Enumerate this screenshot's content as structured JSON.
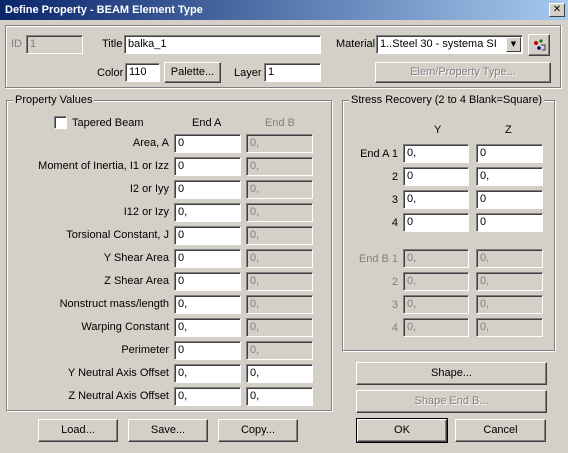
{
  "window": {
    "title": "Define Property - BEAM Element Type",
    "close_glyph": "✕"
  },
  "header": {
    "id_label": "ID",
    "id_value": "1",
    "title_label": "Title",
    "title_value": "balka_1",
    "material_label": "Material",
    "material_value": "1..Steel 30 - systema SI",
    "color_label": "Color",
    "color_value": "110",
    "palette_button": "Palette...",
    "layer_label": "Layer",
    "layer_value": "1",
    "elem_type_button": "Elem/Property Type..."
  },
  "property_values": {
    "group_title": "Property Values",
    "tapered_beam_label": "Tapered Beam",
    "tapered_beam_checked": false,
    "end_a_header": "End A",
    "end_b_header": "End B",
    "rows": [
      {
        "label": "Area, A",
        "end_a": "0",
        "end_b": "0,"
      },
      {
        "label": "Moment of Inertia, I1 or Izz",
        "end_a": "0",
        "end_b": "0,"
      },
      {
        "label": "I2 or Iyy",
        "end_a": "0",
        "end_b": "0,"
      },
      {
        "label": "I12 or Izy",
        "end_a": "0,",
        "end_b": "0,"
      },
      {
        "label": "Torsional Constant, J",
        "end_a": "0",
        "end_b": "0,"
      },
      {
        "label": "Y Shear Area",
        "end_a": "0",
        "end_b": "0,"
      },
      {
        "label": "Z Shear Area",
        "end_a": "0",
        "end_b": "0,"
      },
      {
        "label": "Nonstruct mass/length",
        "end_a": "0,",
        "end_b": "0,"
      },
      {
        "label": "Warping Constant",
        "end_a": "0,",
        "end_b": "0,"
      },
      {
        "label": "Perimeter",
        "end_a": "0",
        "end_b": "0,"
      },
      {
        "label": "Y Neutral Axis Offset",
        "end_a": "0,",
        "end_b": "0,"
      },
      {
        "label": "Z Neutral Axis Offset",
        "end_a": "0,",
        "end_b": "0,"
      }
    ]
  },
  "stress_recovery": {
    "group_title": "Stress Recovery (2 to 4 Blank=Square)",
    "y_header": "Y",
    "z_header": "Z",
    "end_a_rows": [
      {
        "label": "End A 1",
        "y": "0,",
        "z": "0"
      },
      {
        "label": "2",
        "y": "0",
        "z": "0,"
      },
      {
        "label": "3",
        "y": "0,",
        "z": "0"
      },
      {
        "label": "4",
        "y": "0",
        "z": "0"
      }
    ],
    "end_b_rows": [
      {
        "label": "End B 1",
        "y": "0,",
        "z": "0,"
      },
      {
        "label": "2",
        "y": "0,",
        "z": "0,"
      },
      {
        "label": "3",
        "y": "0,",
        "z": "0,"
      },
      {
        "label": "4",
        "y": "0,",
        "z": "0,"
      }
    ]
  },
  "buttons": {
    "shape": "Shape...",
    "shape_end_b": "Shape End B...",
    "load": "Load...",
    "save": "Save...",
    "copy": "Copy...",
    "ok": "OK",
    "cancel": "Cancel"
  }
}
